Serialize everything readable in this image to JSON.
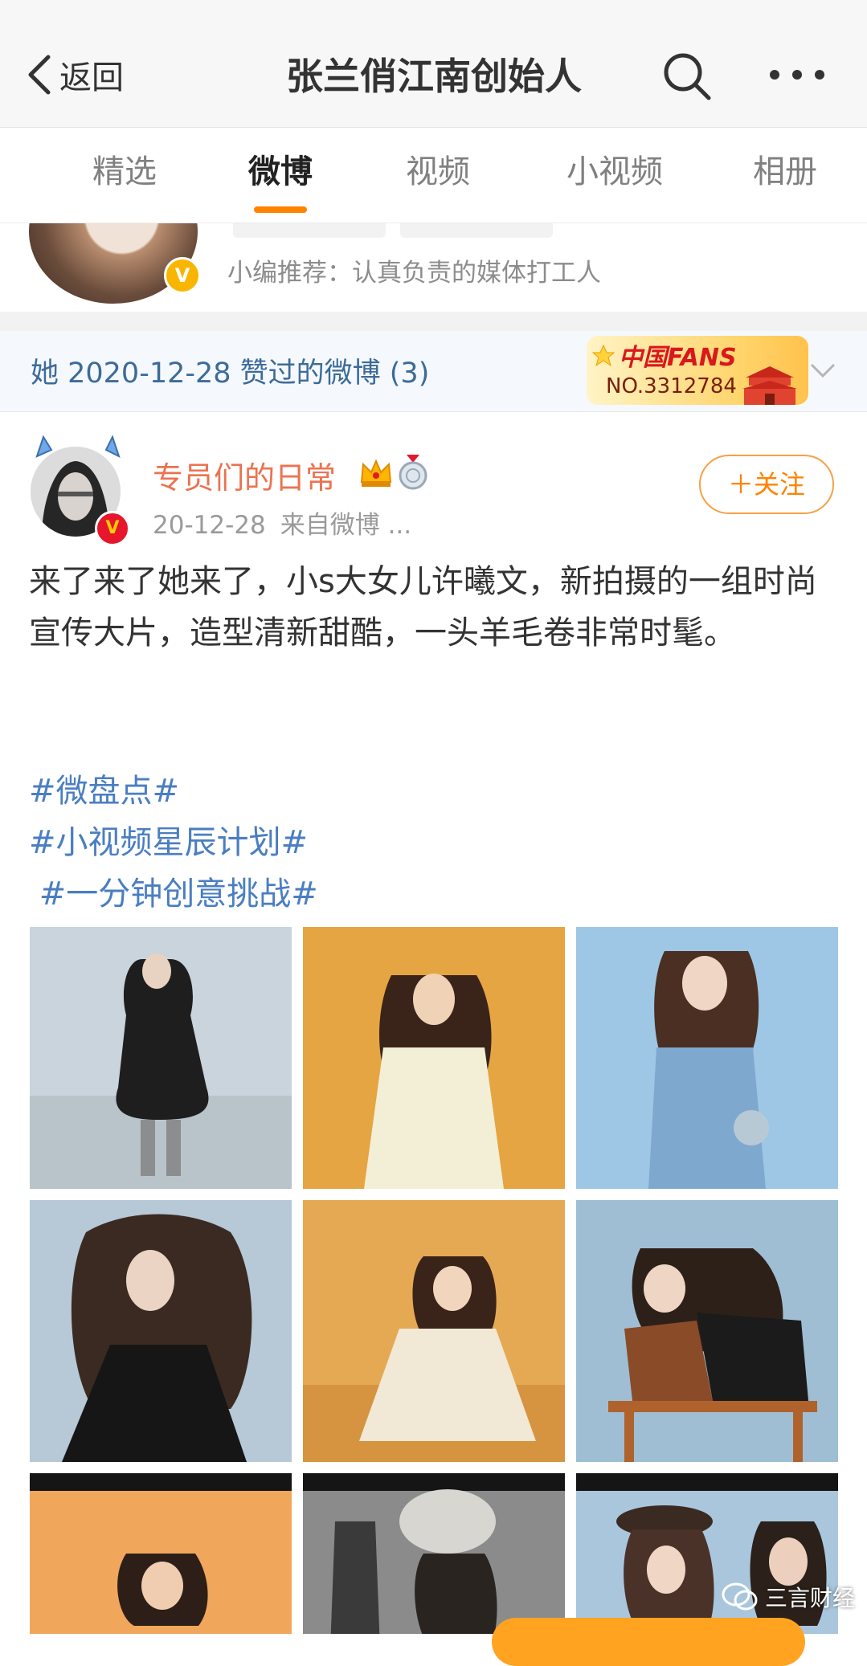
{
  "nav": {
    "back_label": "返回",
    "title": "张兰俏江南创始人",
    "search_icon": "search-icon",
    "more_icon": "more-icon"
  },
  "tabs": [
    {
      "label": "精选",
      "active": false
    },
    {
      "label": "微博",
      "active": true
    },
    {
      "label": "视频",
      "active": false
    },
    {
      "label": "小视频",
      "active": false
    },
    {
      "label": "相册",
      "active": false
    }
  ],
  "profile": {
    "recommendation": "小编推荐：认真负责的媒体打工人"
  },
  "liked": {
    "header": "她 2020-12-28 赞过的微博 (3)",
    "fans_badge_brand": "中国FANS",
    "fans_badge_number": "NO.3312784"
  },
  "post": {
    "author": "专员们的日常",
    "time": "20-12-28",
    "source": "来自微博 ...",
    "follow_label": "＋关注",
    "text": "来了来了她来了，小s大女儿许曦文，新拍摄的一组时尚宣传大片，造型清新甜酷，一头羊毛卷非常时髦。",
    "tags": [
      "#微盘点#",
      "#小视频星辰计划#",
      " #一分钟创意挑战#"
    ]
  },
  "watermark": "三言财经",
  "colors": {
    "accent": "#ff8200",
    "link": "#4a7ec2",
    "author": "#eb7350",
    "liked_header": "#3d6b99"
  }
}
